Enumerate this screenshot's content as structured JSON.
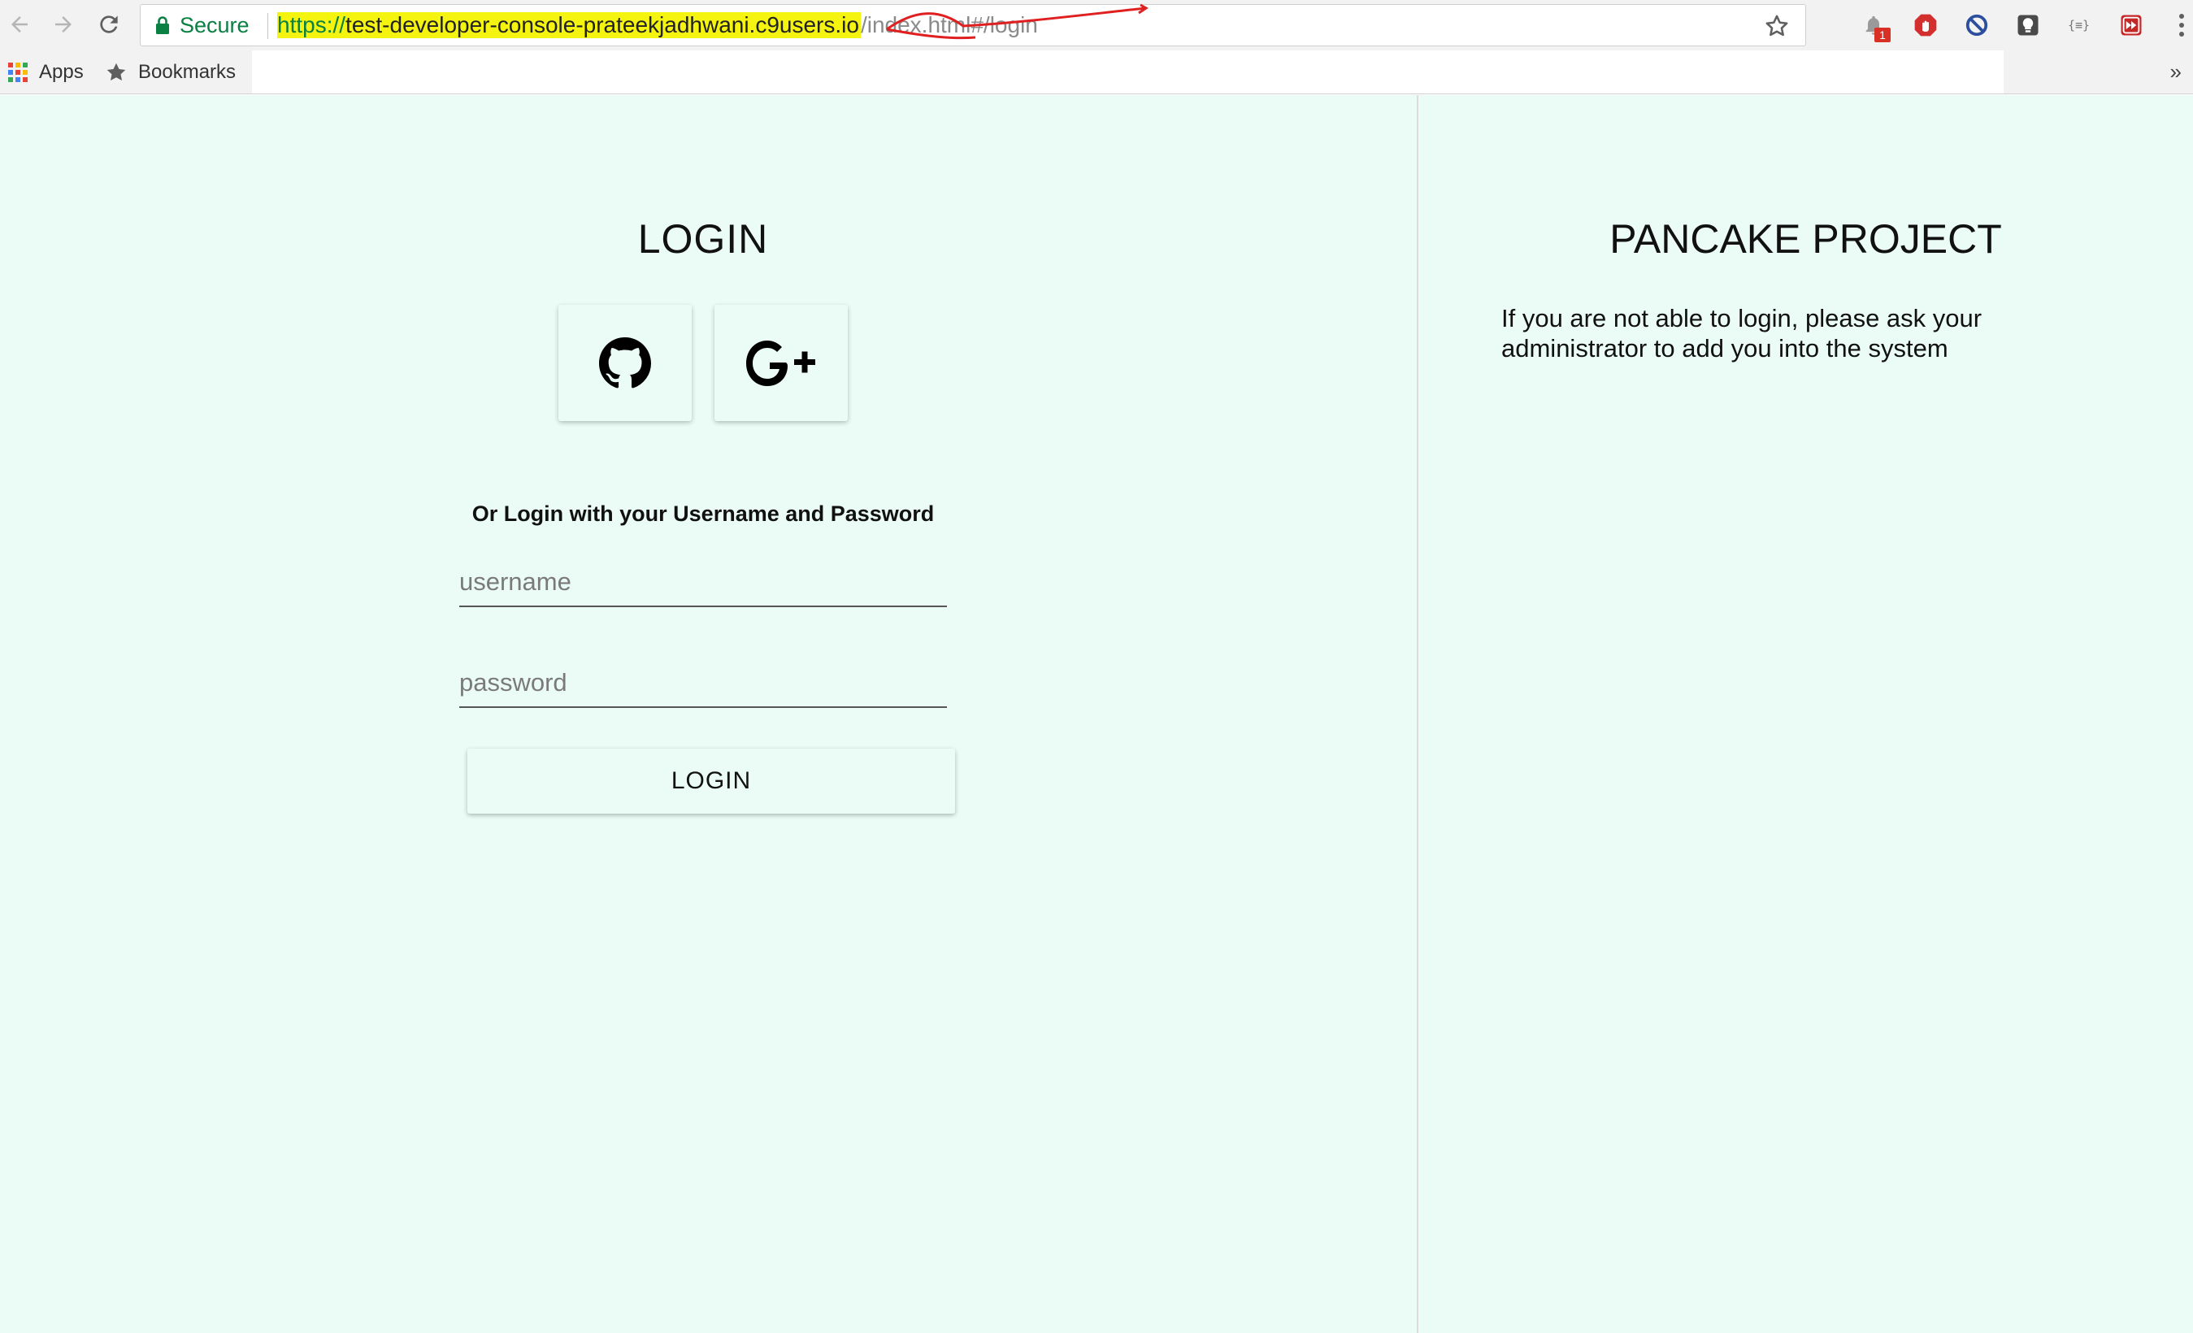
{
  "browser": {
    "security_label": "Secure",
    "url": {
      "scheme": "https://",
      "host": "test-developer-console-prateekjadhwani.c9users.io",
      "host_suffix": "/",
      "path": "index.html#/login"
    },
    "notification_badge": "1",
    "extensions": [
      "notifications-icon",
      "adblock-icon",
      "block-icon",
      "lightbulb-icon",
      "json-icon",
      "fast-forward-icon"
    ],
    "bookmarks": {
      "apps_label": "Apps",
      "bookmarks_label": "Bookmarks",
      "overflow": "»"
    },
    "highlight_color": "#f4f410",
    "annotation_color": "#e02020"
  },
  "login": {
    "title": "LOGIN",
    "social": [
      {
        "name": "github-icon"
      },
      {
        "name": "google-plus-icon",
        "label": "G+"
      }
    ],
    "alt_text": "Or Login with your Username and Password",
    "username_placeholder": "username",
    "password_placeholder": "password",
    "button_label": "LOGIN"
  },
  "project": {
    "title": "PANCAKE PROJECT",
    "note": "If you are not able to login, please ask your administrator to add you into the system"
  },
  "colors": {
    "page_background": "#ebfcf7",
    "secure_green": "#0b8043"
  }
}
